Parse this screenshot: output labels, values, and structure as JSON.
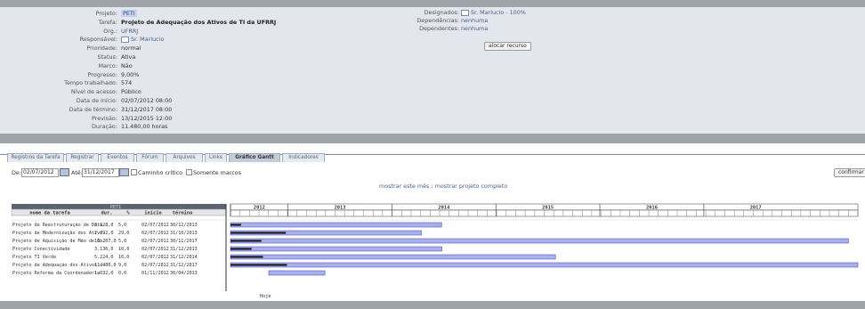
{
  "details": {
    "fields": [
      {
        "label": "Projeto:",
        "value": "PETI",
        "style": "proj"
      },
      {
        "label": "Tarefa:",
        "value": "Projeto de Adequação dos Ativos de TI da UFRRJ",
        "style": "bold"
      },
      {
        "label": "Org.:",
        "value": "UFRRJ",
        "style": "link"
      },
      {
        "label": "Responsável:",
        "value": "Sr. Marlucio",
        "style": "user"
      },
      {
        "label": "Prioridade:",
        "value": "normal",
        "style": ""
      },
      {
        "label": "Status:",
        "value": "Ativa",
        "style": ""
      },
      {
        "label": "Marco:",
        "value": "Não",
        "style": ""
      },
      {
        "label": "Progresso:",
        "value": "9,00%",
        "style": ""
      },
      {
        "label": "Tempo trabalhado:",
        "value": "574",
        "style": ""
      },
      {
        "label": "Nível de acesso:",
        "value": "Público",
        "style": ""
      },
      {
        "label": "Data de início:",
        "value": "02/07/2012 08:00",
        "style": ""
      },
      {
        "label": "Data de término:",
        "value": "31/12/2017 08:00",
        "style": ""
      },
      {
        "label": "Previsão:",
        "value": "13/12/2015 12:00",
        "style": ""
      },
      {
        "label": "Duração:",
        "value": "11.480,00 horas",
        "style": ""
      }
    ],
    "right": {
      "designados_label": "Designados:",
      "designados_value": "Sr. Marlucio - 100%",
      "dependencias_label": "Dependências:",
      "dependencias_value": "nenhuma",
      "dependentes_label": "Dependentes:",
      "dependentes_value": "nenhuma",
      "alocar_button": "alocar recurso"
    }
  },
  "tabs": [
    {
      "label": "Registros da Tarefa",
      "active": false
    },
    {
      "label": "Registrar",
      "active": false
    },
    {
      "label": "Eventos",
      "active": false
    },
    {
      "label": "Fórum",
      "active": false
    },
    {
      "label": "Arquivos",
      "active": false
    },
    {
      "label": "Links",
      "active": false
    },
    {
      "label": "Gráfico Gantt",
      "active": true
    },
    {
      "label": "Indicadores",
      "active": false
    }
  ],
  "toolbar": {
    "de_label": "De:",
    "de_value": "02/07/2012",
    "ate_label": "Até:",
    "ate_value": "31/12/2017",
    "caminho_label": "Caminho crítico",
    "marcos_label": "Somente marcos",
    "confirm_button": "confirmar",
    "link_mes": "mostrar este mês",
    "link_sep": ":",
    "link_completo": "mostrar projeto completo"
  },
  "gantt": {
    "project_label": "PETI",
    "headers": {
      "name": "nome da tarefa",
      "dur": "dur.",
      "pct": "%",
      "start": "início",
      "end": "término"
    },
    "years": [
      "2012",
      "2013",
      "2014",
      "2015",
      "2016",
      "2017"
    ],
    "today_label": "Hoje",
    "rows": [
      {
        "name": "Projeto de Reestruturação de Data.",
        "dur": "3.128,0",
        "pct": "5,0",
        "start": "02/07/2012",
        "end": "30/12/2013",
        "s": 0.0,
        "e": 0.3365,
        "p": 0.05
      },
      {
        "name": "Projeto de Modernização dos Ativo.",
        "dur": "2.792,0",
        "pct": "29,0",
        "start": "02/07/2012",
        "end": "31/10/2013",
        "s": 0.0,
        "e": 0.3042,
        "p": 0.29
      },
      {
        "name": "Projeto de Aquisição de Mão de Ob.",
        "dur": "11.207,0",
        "pct": "5,0",
        "start": "02/07/2012",
        "end": "30/11/2017",
        "s": 0.0,
        "e": 0.985,
        "p": 0.05
      },
      {
        "name": "Projeto Conectividade",
        "dur": "3.136,0",
        "pct": "10,0",
        "start": "02/07/2012",
        "end": "31/12/2013",
        "s": 0.0,
        "e": 0.337,
        "p": 0.1
      },
      {
        "name": "Projeto TI Verde",
        "dur": "5.224,0",
        "pct": "10,0",
        "start": "02/07/2012",
        "end": "31/12/2014",
        "s": 0.0,
        "e": 0.518,
        "p": 0.1
      },
      {
        "name": "Projeto de Adequação dos Ativos d.",
        "dur": "11.480,0",
        "pct": "9,0",
        "start": "02/07/2012",
        "end": "31/12/2017",
        "s": 0.0,
        "e": 1.0,
        "p": 0.09
      },
      {
        "name": "Projeto Reforma da Coordenadoria .",
        "dur": "1.032,0",
        "pct": "0,0",
        "start": "01/11/2012",
        "end": "30/04/2013",
        "s": 0.061,
        "e": 0.1505,
        "p": 0.0
      }
    ]
  }
}
